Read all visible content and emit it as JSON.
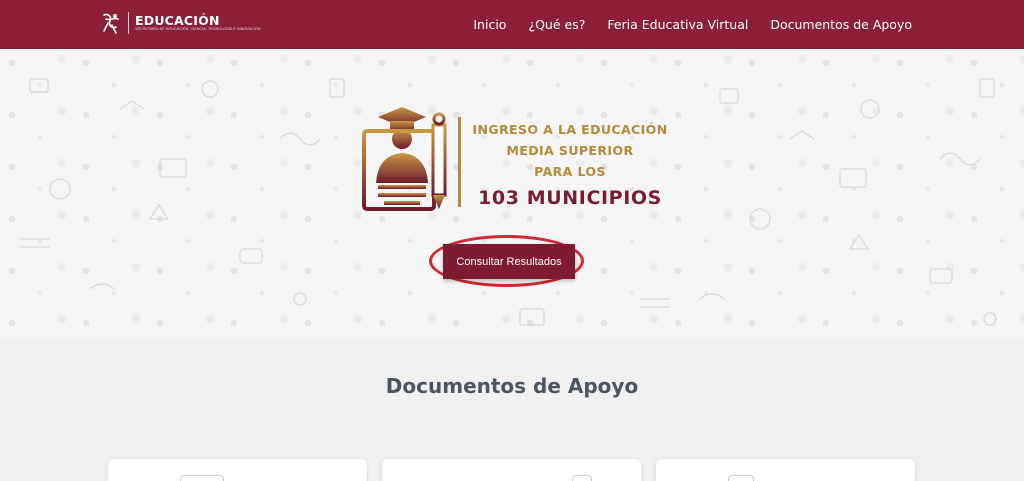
{
  "navbar": {
    "brand_title": "EDUCACIÓN",
    "brand_subtitle": "SECRETARÍA DE EDUCACIÓN, CIENCIA, TECNOLOGÍA E INNOVACIÓN",
    "links": [
      "Inicio",
      "¿Qué es?",
      "Feria Educativa Virtual",
      "Documentos de Apoyo"
    ]
  },
  "hero": {
    "logo_lines": [
      "INGRESO A LA EDUCACIÓN",
      "MEDIA SUPERIOR",
      "PARA LOS"
    ],
    "logo_highlight": "103 MUNICIPIOS",
    "cta_label": "Consultar Resultados"
  },
  "documents": {
    "title": "Documentos de Apoyo"
  },
  "colors": {
    "brand": "#8b1f35",
    "gold": "#b58a3a",
    "highlight_ring": "#d22734"
  }
}
